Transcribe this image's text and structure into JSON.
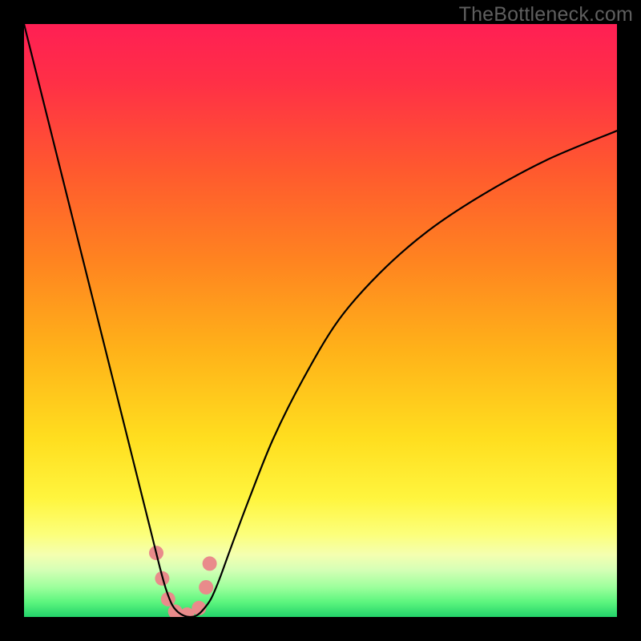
{
  "watermark": "TheBottleneck.com",
  "chart_data": {
    "type": "line",
    "title": "",
    "xlabel": "",
    "ylabel": "",
    "xlim": [
      0,
      100
    ],
    "ylim": [
      0,
      100
    ],
    "gradient_stops": [
      {
        "offset": 0.0,
        "color": "#ff1f54"
      },
      {
        "offset": 0.1,
        "color": "#ff3046"
      },
      {
        "offset": 0.25,
        "color": "#ff5a2e"
      },
      {
        "offset": 0.4,
        "color": "#ff8420"
      },
      {
        "offset": 0.55,
        "color": "#ffb219"
      },
      {
        "offset": 0.7,
        "color": "#ffde1f"
      },
      {
        "offset": 0.8,
        "color": "#fff53e"
      },
      {
        "offset": 0.86,
        "color": "#fcff7a"
      },
      {
        "offset": 0.895,
        "color": "#f4ffb0"
      },
      {
        "offset": 0.92,
        "color": "#d6ffb6"
      },
      {
        "offset": 0.95,
        "color": "#9cff9c"
      },
      {
        "offset": 0.975,
        "color": "#5cf57e"
      },
      {
        "offset": 1.0,
        "color": "#23d36a"
      }
    ],
    "series": [
      {
        "name": "bottleneck-curve",
        "x": [
          0.0,
          2.5,
          5.0,
          7.5,
          10.0,
          12.5,
          15.0,
          17.5,
          20.0,
          21.5,
          23.0,
          24.0,
          25.0,
          26.0,
          27.0,
          28.0,
          29.0,
          30.0,
          31.5,
          33.0,
          35.0,
          38.0,
          42.0,
          47.0,
          53.0,
          60.0,
          68.0,
          77.0,
          88.0,
          100.0
        ],
        "y": [
          100.0,
          90.0,
          80.0,
          70.0,
          60.0,
          50.0,
          40.0,
          30.0,
          20.0,
          14.0,
          8.0,
          4.5,
          2.0,
          0.8,
          0.2,
          0.0,
          0.2,
          1.0,
          3.0,
          6.5,
          12.0,
          20.0,
          30.0,
          40.0,
          50.0,
          58.0,
          65.0,
          71.0,
          77.0,
          82.0
        ]
      }
    ],
    "markers": {
      "name": "highlight-dots",
      "color": "#e98b8b",
      "radius_px": 9,
      "points": [
        {
          "x": 22.3,
          "y": 10.8
        },
        {
          "x": 23.3,
          "y": 6.5
        },
        {
          "x": 24.3,
          "y": 3.0
        },
        {
          "x": 25.5,
          "y": 0.9
        },
        {
          "x": 27.5,
          "y": 0.4
        },
        {
          "x": 29.5,
          "y": 1.5
        },
        {
          "x": 30.7,
          "y": 5.0
        },
        {
          "x": 31.3,
          "y": 9.0
        }
      ]
    }
  }
}
